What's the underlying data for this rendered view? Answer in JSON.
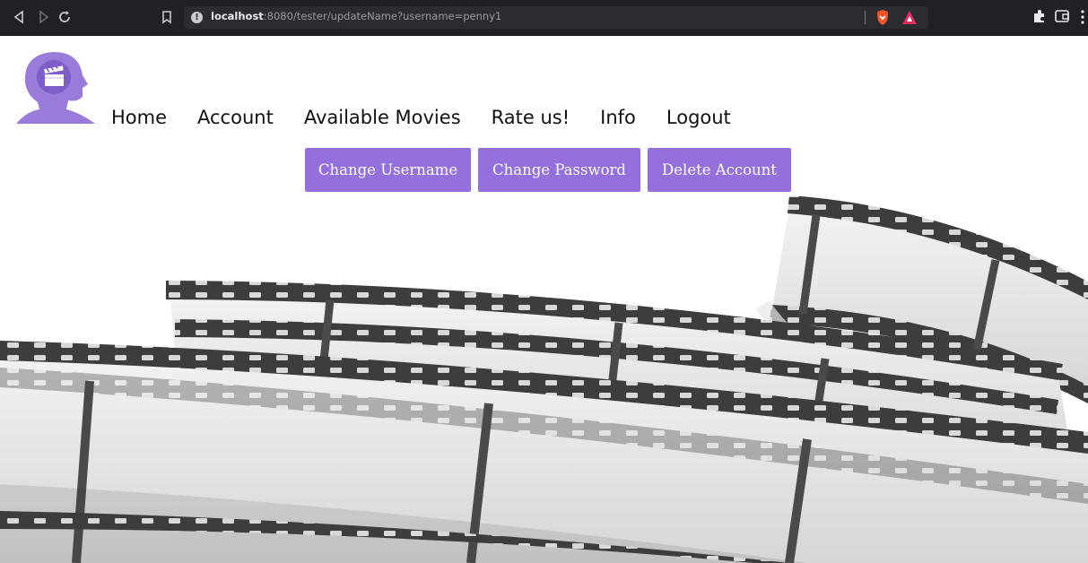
{
  "browser": {
    "url_host": "localhost",
    "url_rest": ":8080/tester/updateName?username=penny1"
  },
  "nav": {
    "home": "Home",
    "account": "Account",
    "available_movies": "Available Movies",
    "rate_us": "Rate us!",
    "info": "Info",
    "logout": "Logout"
  },
  "actions": {
    "change_username": "Change Username",
    "change_password": "Change Password",
    "delete_account": "Delete Account"
  },
  "icons": {
    "back": "back-arrow-icon",
    "forward": "forward-arrow-icon",
    "reload": "reload-icon",
    "bookmark": "bookmark-icon",
    "site_info": "info-icon",
    "shield": "brave-shield-icon",
    "rewards": "brave-rewards-icon",
    "extensions": "puzzle-icon",
    "wallet": "wallet-icon",
    "menu": "menu-dots-icon",
    "logo": "head-clapperboard-logo"
  },
  "colors": {
    "accent": "#9370db",
    "logo": "#9b7bd9",
    "chrome": "#202124",
    "shield": "#fb542b"
  }
}
